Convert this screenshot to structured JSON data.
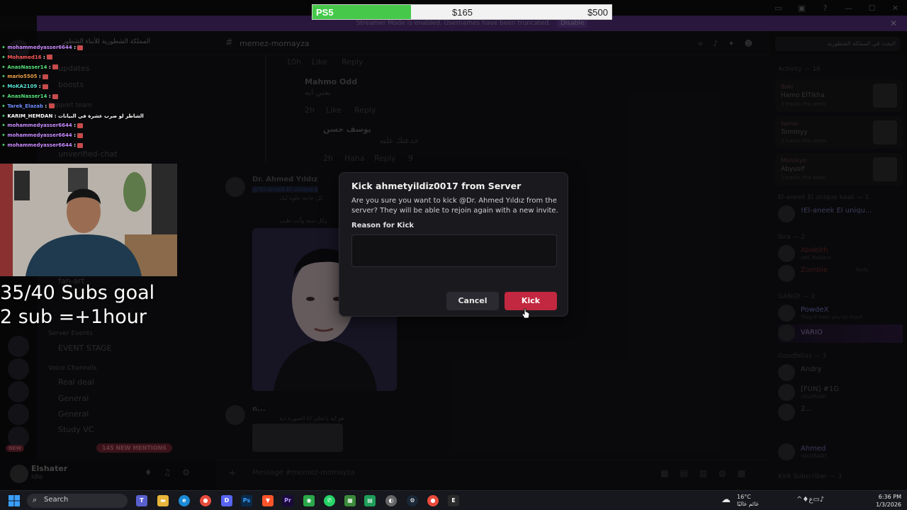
{
  "donation": {
    "item": "PS5",
    "current": "$165",
    "goal": "$500",
    "progress": 0.33
  },
  "banner": {
    "text": "Streamer Mode is enabled. Usernames have been truncated.",
    "disable": "Disable"
  },
  "server": {
    "name": "المملكة الشطورية للأبناء الشطور"
  },
  "channels": {
    "items": [
      {
        "label": "updates"
      },
      {
        "label": "boosts"
      },
      {
        "label": "unverified-chat"
      },
      {
        "label": "fan-art"
      },
      {
        "label": "EVENT STAGE"
      },
      {
        "label": "Real deal"
      },
      {
        "label": "General"
      },
      {
        "label": "General"
      },
      {
        "label": "Study VC"
      }
    ],
    "categories": [
      {
        "label": "Support team"
      },
      {
        "label": "Server Events"
      },
      {
        "label": "Voice Channels"
      }
    ]
  },
  "chat_header": {
    "channel": "memez-momayza"
  },
  "search": {
    "placeholder": "البحث في المملكة الشطورية"
  },
  "thread": {
    "lines": [
      {
        "time": "10h",
        "like": "Like",
        "reply": "Reply"
      },
      {
        "author": "Mahmo Odd",
        "text": "يعني ايه"
      },
      {
        "time": "2h",
        "like": "Like",
        "reply": "Reply"
      },
      {
        "author": "يوسف حسن",
        "text": "خدعتك عليه"
      },
      {
        "time": "2h",
        "like": "Haha",
        "reply": "Reply",
        "count": "9"
      }
    ]
  },
  "message": {
    "author": "Dr. Ahmed Yıldız",
    "mention": "@!El-aneek El unique k",
    "text1": "كل حاجة حلوة ليك",
    "text2": "وكل سنة وأنت طيب"
  },
  "message2": {
    "author": "n...",
    "text": "هو ايه باعتلي انا الصورة دية"
  },
  "composer": {
    "placeholder": "Message #memez-momayza"
  },
  "user": {
    "name": "Elshater",
    "status": "Idle"
  },
  "new_mentions": "145 NEW MENTIONS",
  "new_pill": "NEW",
  "members": {
    "activity_title": "Activity — 16",
    "activities": [
      {
        "top": "Baki",
        "name": "Hamo ElTikha",
        "sub": "3 tracks this week"
      },
      {
        "top": "kamal",
        "name": "Tommyy",
        "sub": "2 tracks this week"
      },
      {
        "top": "Monokyo",
        "name": "Abyusif",
        "sub": "1 tracks this week"
      }
    ],
    "groups": [
      {
        "label": "El-aneek El unique kaak — 1"
      },
      {
        "label": "Ibra — 2"
      },
      {
        "label": "GANGY — 2"
      },
      {
        "label": "Goodfellas — 3"
      },
      {
        "label": "Kick Subscriber — 3"
      }
    ],
    "people": [
      {
        "name": "!El-aneek El uniqu...",
        "sub": ""
      },
      {
        "name": "Abdelrh",
        "sub": "ARC Raiders"
      },
      {
        "name": "Zombie",
        "sub": "Rudy"
      },
      {
        "name": "PowdeX",
        "sub": "They'll hate you so much"
      },
      {
        "name": "VARIO",
        "sub": ""
      },
      {
        "name": "Andry",
        "sub": ""
      },
      {
        "name": "[FUN] #1G",
        "sub": "VALORANT"
      },
      {
        "name": "2...",
        "sub": ""
      },
      {
        "name": "Ahmed",
        "sub": "VALORANT"
      }
    ]
  },
  "stream_chat": [
    {
      "user": "mohammedyasser6644",
      "color": "#c98bff",
      "msg": ""
    },
    {
      "user": "Mohamed16",
      "color": "#ff5a5a",
      "msg": ""
    },
    {
      "user": "AnasNasser14",
      "color": "#57e07a",
      "msg": ""
    },
    {
      "user": "mario5505",
      "color": "#f0a34a",
      "msg": ""
    },
    {
      "user": "MoKA2109",
      "color": "#57e0d0",
      "msg": ""
    },
    {
      "user": "AnasNasser14",
      "color": "#57e07a",
      "msg": ""
    },
    {
      "user": "Tarek_Elazab",
      "color": "#6f8dff",
      "msg": ""
    },
    {
      "user": "KARIM_HEMDAN",
      "color": "#ffffff",
      "msg": "الشاطر لو ضرب عشرة في البيانات"
    },
    {
      "user": "mohammedyasser6644",
      "color": "#c98bff",
      "msg": ""
    },
    {
      "user": "mohammedyasser6644",
      "color": "#c98bff",
      "msg": ""
    },
    {
      "user": "mohammedyasser6644",
      "color": "#c98bff",
      "msg": ""
    }
  ],
  "goal": {
    "line1": "35/40 Subs goal",
    "line2": "2 sub =+1hour"
  },
  "modal": {
    "title": "Kick ahmetyildiz0017 from Server",
    "description": "Are you sure you want to kick @Dr. Ahmed Yıldız from the server? They will be able to rejoin again with a new invite.",
    "reason_label": "Reason for Kick",
    "reason_value": "",
    "cancel": "Cancel",
    "kick": "Kick"
  },
  "taskbar": {
    "search": "Search",
    "weather_temp": "16°C",
    "weather_desc": "غائم غالبًا",
    "time": "6:36 PM",
    "date": "1/3/2026"
  },
  "colors": {
    "accent": "#c2283f",
    "banner": "#4b2a6f",
    "progress": "#46c94a"
  }
}
